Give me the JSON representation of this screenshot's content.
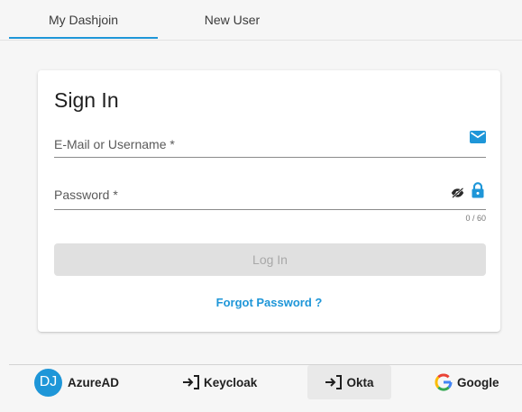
{
  "tabs": [
    {
      "label": "My Dashjoin",
      "active": true
    },
    {
      "label": "New User",
      "active": false
    }
  ],
  "signin": {
    "title": "Sign In",
    "email_placeholder": "E-Mail or Username *",
    "email_value": "",
    "password_placeholder": "Password *",
    "password_value": "",
    "password_counter": "0 / 60",
    "login_label": "Log In",
    "forgot_label": "Forgot Password ?"
  },
  "providers": [
    {
      "label": "AzureAD",
      "badge": "DJ",
      "icon": "dj-avatar-icon"
    },
    {
      "label": "Keycloak",
      "icon": "login-icon"
    },
    {
      "label": "Okta",
      "icon": "login-icon"
    },
    {
      "label": "Google",
      "icon": "google-icon"
    }
  ],
  "colors": {
    "accent": "#1e96d8",
    "disabled_button": "#e0e0e0",
    "disabled_text": "#a8a8a8"
  },
  "icons": {
    "email": "mail-icon",
    "password_visibility": "eye-off-icon",
    "password": "lock-icon"
  }
}
